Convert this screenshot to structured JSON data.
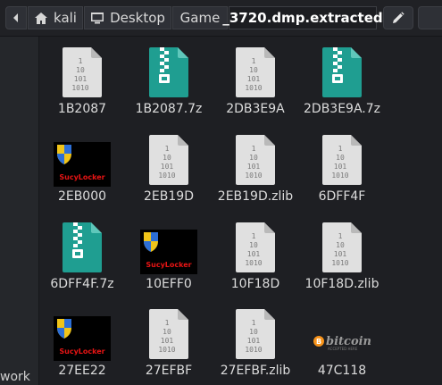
{
  "pathbar": {
    "crumbs": [
      "kali",
      "Desktop",
      "Game",
      "_3720.dmp.extracted"
    ],
    "home_icon": "home-icon",
    "desktop_icon": "desktop-icon",
    "back_icon": "chevron-left-icon",
    "forward_icon": "chevron-right-icon",
    "edit_icon": "pencil-icon"
  },
  "sidebar": {
    "label": "work"
  },
  "thumb_text": {
    "locker": "SucyLocker",
    "bitcoin": "bitcoin",
    "bitcoin_sub": "ACCEPTED HERE"
  },
  "colors": {
    "archive": "#1f9e91",
    "document": "#e0e0e0",
    "locker_text": "#e81414",
    "background": "#1e1f23"
  },
  "files": [
    {
      "name": "1B2087",
      "type": "binary"
    },
    {
      "name": "1B2087.7z",
      "type": "archive"
    },
    {
      "name": "2DB3E9A",
      "type": "binary"
    },
    {
      "name": "2DB3E9A.7z",
      "type": "archive"
    },
    {
      "name": "2EB000",
      "type": "locker-image"
    },
    {
      "name": "2EB19D",
      "type": "binary"
    },
    {
      "name": "2EB19D.zlib",
      "type": "binary"
    },
    {
      "name": "6DFF4F",
      "type": "binary"
    },
    {
      "name": "6DFF4F.7z",
      "type": "archive"
    },
    {
      "name": "10EFF0",
      "type": "locker-image"
    },
    {
      "name": "10F18D",
      "type": "binary"
    },
    {
      "name": "10F18D.zlib",
      "type": "binary"
    },
    {
      "name": "27EE22",
      "type": "locker-image"
    },
    {
      "name": "27EFBF",
      "type": "binary"
    },
    {
      "name": "27EFBF.zlib",
      "type": "binary"
    },
    {
      "name": "47C118",
      "type": "bitcoin-image"
    }
  ]
}
